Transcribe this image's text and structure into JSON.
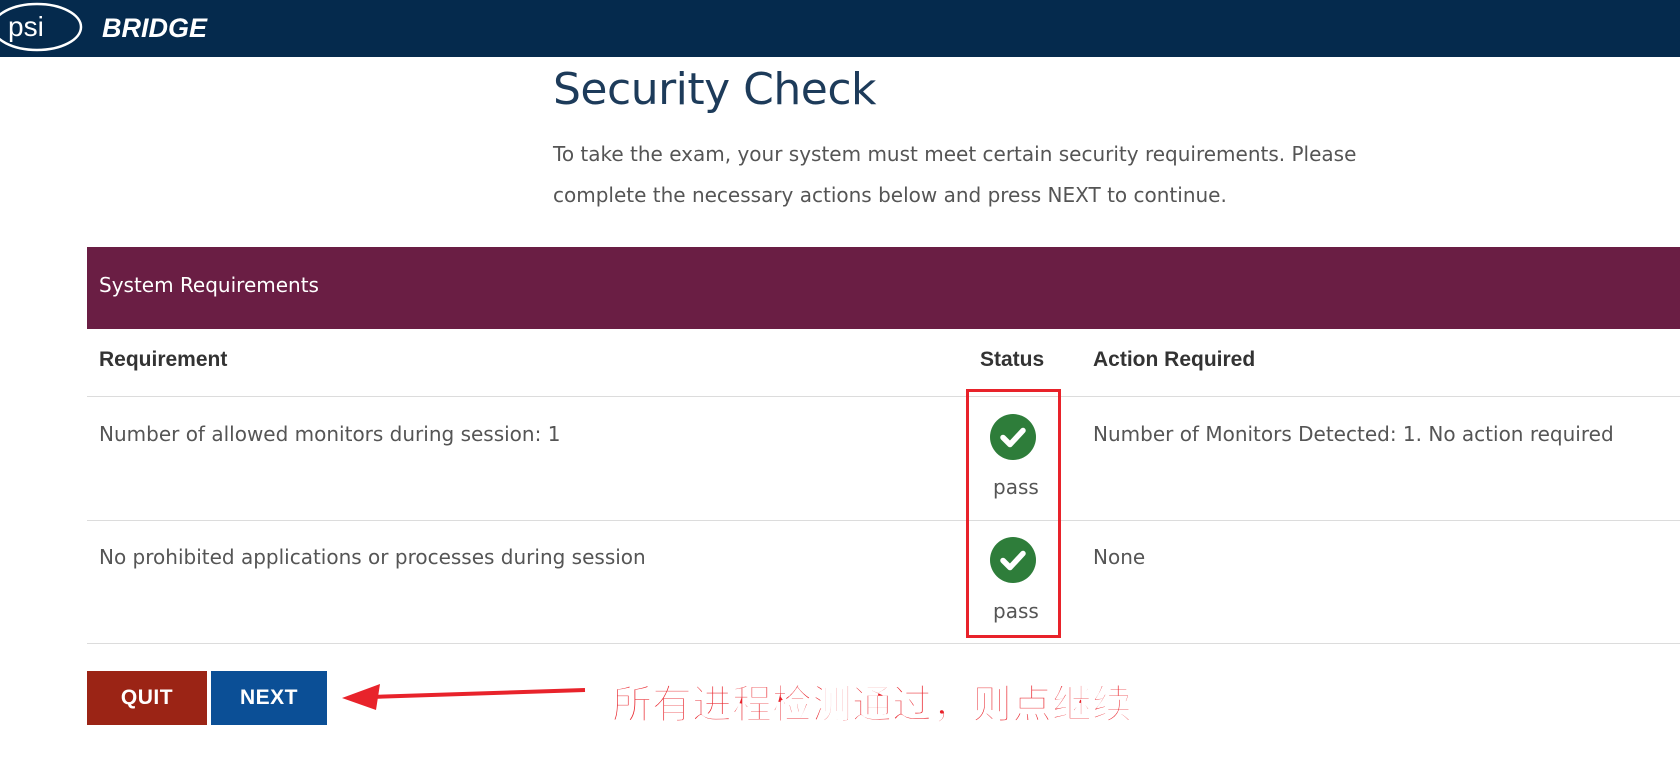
{
  "header": {
    "brand_left": "psi",
    "brand_right": "BRIDGE"
  },
  "page": {
    "title": "Security Check",
    "intro_line1": "To take the exam, your system must meet certain security requirements. Please",
    "intro_line2": "complete the necessary actions below and press NEXT to continue."
  },
  "panel": {
    "title": "System Requirements",
    "columns": {
      "requirement": "Requirement",
      "status": "Status",
      "action": "Action Required"
    },
    "rows": [
      {
        "requirement": "Number of allowed monitors during session: 1",
        "status": "pass",
        "action": "Number of Monitors Detected: 1. No action required"
      },
      {
        "requirement": "No prohibited applications or processes during session",
        "status": "pass",
        "action": "None"
      }
    ]
  },
  "buttons": {
    "quit": "QUIT",
    "next": "NEXT"
  },
  "annotation": {
    "text": "所有进程检测通过，则点继续"
  },
  "colors": {
    "header_bg": "#052a4d",
    "panel_bg": "#6a1e44",
    "pass_green": "#2e7d3a",
    "quit_bg": "#9b2415",
    "next_bg": "#0b4f96",
    "annotation_red": "#e8232b"
  },
  "icons": {
    "status_pass": "check-circle-icon",
    "annotation_arrow": "arrow-left-icon"
  }
}
